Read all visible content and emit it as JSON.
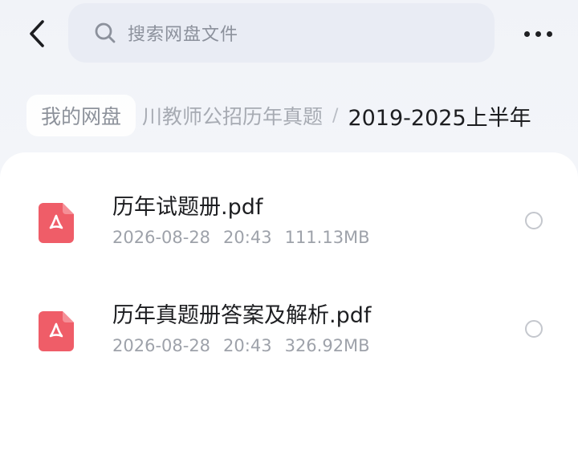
{
  "topbar": {
    "back_icon": "chevron-left-icon",
    "search": {
      "icon": "search-icon",
      "placeholder": "搜索网盘文件"
    },
    "more_icon": "more-horizontal-icon"
  },
  "breadcrumb": {
    "root": "我的网盘",
    "middle": "川教师公招历年真题",
    "separator": "/",
    "current": "2019-2025上半年"
  },
  "files": [
    {
      "name": "历年试题册.pdf",
      "date": "2026-08-28",
      "time": "20:43",
      "size": "111.13MB",
      "icon": "pdf-file-icon",
      "selected": false
    },
    {
      "name": "历年真题册答案及解析.pdf",
      "date": "2026-08-28",
      "time": "20:43",
      "size": "326.92MB",
      "icon": "pdf-file-icon",
      "selected": false
    }
  ],
  "colors": {
    "pdf_icon": "#ef5d68",
    "search_bg": "#e9ecf4",
    "text_primary": "#1d1e21",
    "text_secondary": "#9ea2aa"
  }
}
